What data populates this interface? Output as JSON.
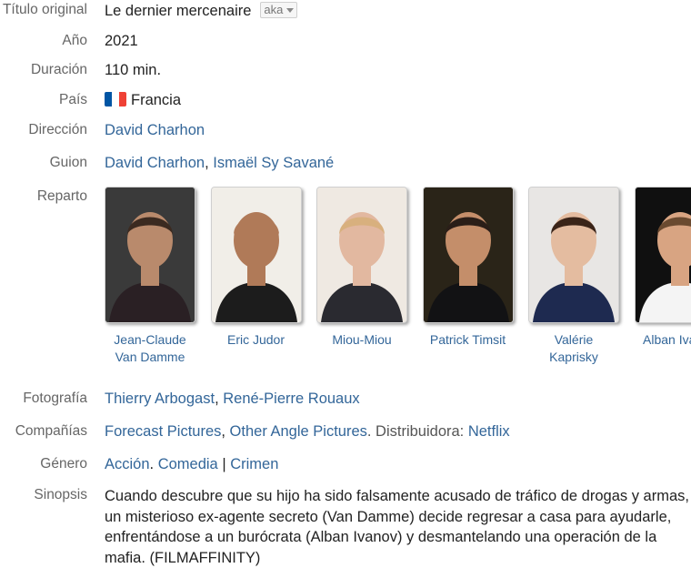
{
  "original_title": {
    "label": "Título original",
    "value": "Le dernier mercenaire",
    "aka_label": "aka"
  },
  "year": {
    "label": "Año",
    "value": "2021"
  },
  "duration": {
    "label": "Duración",
    "value": "110 min."
  },
  "country": {
    "label": "País",
    "value": "Francia",
    "flag_colors": [
      "#0055A4",
      "#FFFFFF",
      "#EF4135"
    ]
  },
  "direction": {
    "label": "Dirección",
    "names": [
      "David Charhon"
    ]
  },
  "script": {
    "label": "Guion",
    "names": [
      "David Charhon",
      "Ismaël Sy Savané"
    ],
    "separator": ", "
  },
  "cast": {
    "label": "Reparto",
    "members": [
      {
        "name": "Jean-Claude Van Damme",
        "bg": "#3a3a3a",
        "skin": "#b98a6c",
        "hair": "#3b2a20",
        "clothes": "#2a2024"
      },
      {
        "name": "Eric Judor",
        "bg": "#f1eee8",
        "skin": "#b07a58",
        "hair": "#b07a58",
        "clothes": "#1c1c1c"
      },
      {
        "name": "Miou-Miou",
        "bg": "#efe9e2",
        "skin": "#e2b8a0",
        "hair": "#d8b07e",
        "clothes": "#2a2a30"
      },
      {
        "name": "Patrick Timsit",
        "bg": "#2a2418",
        "skin": "#c48e6a",
        "hair": "#2a1e18",
        "clothes": "#121214"
      },
      {
        "name": "Valérie Kaprisky",
        "bg": "#e8e6e4",
        "skin": "#e4bca0",
        "hair": "#3a2418",
        "clothes": "#1e2a50"
      },
      {
        "name": "Alban Ivanov",
        "bg": "#101010",
        "skin": "#d8a482",
        "hair": "#6a4a30",
        "clothes": "#f4f4f4"
      }
    ]
  },
  "photography": {
    "label": "Fotografía",
    "names": [
      "Thierry Arbogast",
      "René-Pierre Rouaux"
    ],
    "separator": ", "
  },
  "companies": {
    "label": "Compañías",
    "names": [
      "Forecast Pictures",
      "Other Angle Pictures"
    ],
    "separator": ", ",
    "suffix": ". Distribuidora: ",
    "distributor": "Netflix"
  },
  "genre": {
    "label": "Género",
    "items": [
      "Acción",
      "Comedia",
      "Crimen"
    ],
    "sep1": ". ",
    "sep2": " | "
  },
  "synopsis": {
    "label": "Sinopsis",
    "text": "Cuando descubre que su hijo ha sido falsamente acusado de tráfico de drogas y armas, un misterioso ex-agente secreto (Van Damme) decide regresar a casa para ayudarle, enfrentándose a un burócrata (Alban Ivanov) y desmantelando una operación de la mafia. (FILMAFFINITY)"
  },
  "colors": {
    "link": "#336699",
    "label": "#666666",
    "text": "#222222"
  }
}
